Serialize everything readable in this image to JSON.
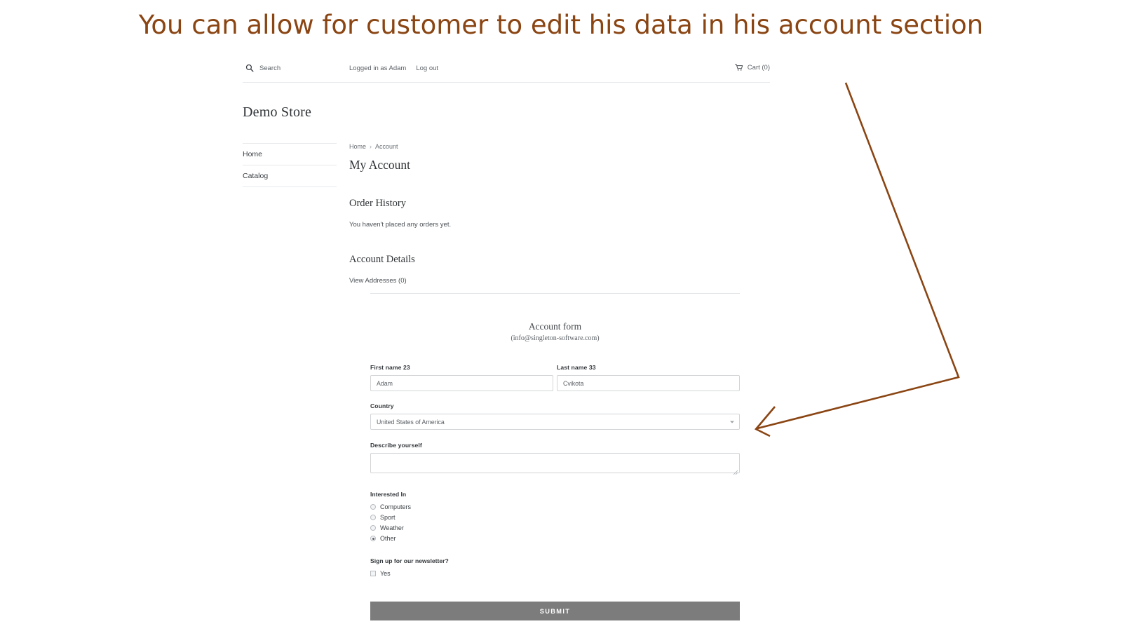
{
  "annotation": {
    "title": "You can allow for customer to edit his data in his account section",
    "title_color": "#8a4513",
    "arrow_color": "#8a4513"
  },
  "header": {
    "search_icon": "search-icon",
    "search_label": "Search",
    "logged_in_label": "Logged in as Adam",
    "logout_label": "Log out",
    "cart_icon": "shopping-cart-icon",
    "cart_label": "Cart (0)"
  },
  "store": {
    "title": "Demo Store"
  },
  "sidebar": {
    "items": [
      {
        "label": "Home"
      },
      {
        "label": "Catalog"
      }
    ]
  },
  "main": {
    "breadcrumb": {
      "home": "Home",
      "separator": "›",
      "current": "Account"
    },
    "page_title": "My Account",
    "order_history": {
      "title": "Order History",
      "empty_text": "You haven't placed any orders yet."
    },
    "account_details": {
      "title": "Account Details",
      "addresses_link": "View Addresses (0)"
    }
  },
  "form": {
    "heading": "Account form",
    "subheading": "(info@singleton-software.com)",
    "first_name": {
      "label": "First name 23",
      "value": "Adam",
      "placeholder": "First name"
    },
    "last_name": {
      "label": "Last name 33",
      "value": "Cvikota",
      "placeholder": "Last name"
    },
    "country": {
      "label": "Country",
      "value": "United States of America"
    },
    "describe": {
      "label": "Describe yourself",
      "value": "",
      "placeholder": ""
    },
    "interested_in": {
      "label": "Interested In",
      "options": [
        {
          "label": "Computers",
          "checked": false
        },
        {
          "label": "Sport",
          "checked": false
        },
        {
          "label": "Weather",
          "checked": false
        },
        {
          "label": "Other",
          "checked": true
        }
      ]
    },
    "newsletter": {
      "label": "Sign up for our newsletter?",
      "options": [
        {
          "label": "Yes",
          "checked": false
        }
      ]
    },
    "submit_label": "SUBMIT",
    "submit_color": "#7c7c7c"
  }
}
